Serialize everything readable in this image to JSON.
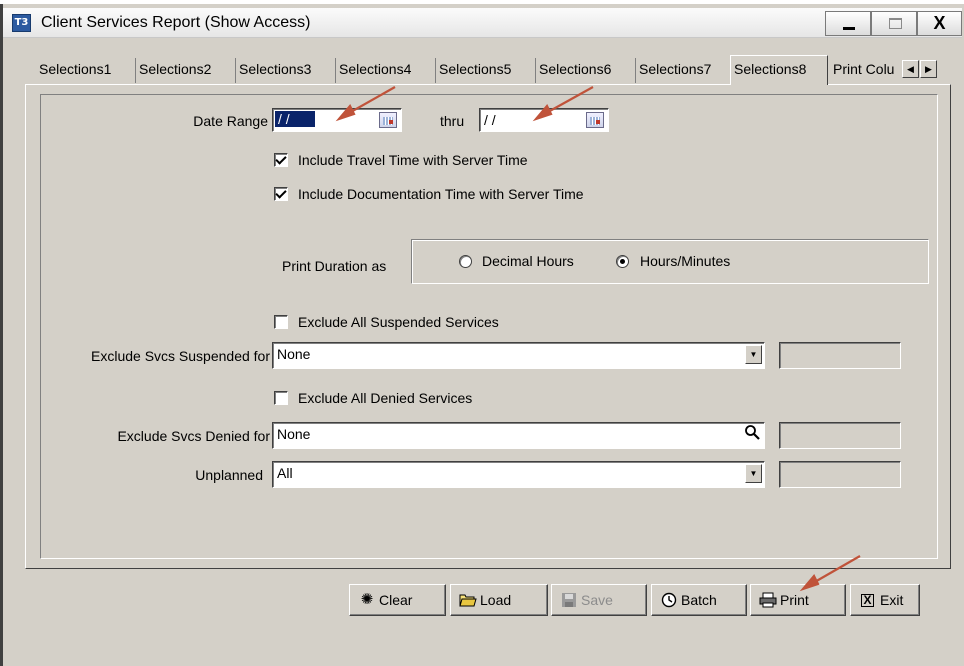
{
  "window": {
    "icon_text": "T3",
    "title": "Client Services Report (Show Access)",
    "min_icon": "minimize-icon",
    "max_icon": "maximize-icon",
    "close_label": "X"
  },
  "tabs": [
    {
      "label": "Selections1"
    },
    {
      "label": "Selections2"
    },
    {
      "label": "Selections3"
    },
    {
      "label": "Selections4"
    },
    {
      "label": "Selections5"
    },
    {
      "label": "Selections6"
    },
    {
      "label": "Selections7"
    },
    {
      "label": "Selections8",
      "active": true
    },
    {
      "label": "Print Colu"
    }
  ],
  "form": {
    "date_range_label": "Date Range",
    "date_from": "/ /",
    "thru_label": "thru",
    "date_to": "/ /",
    "include_travel": {
      "label": "Include Travel Time with Server Time",
      "checked": true
    },
    "include_doc": {
      "label": "Include Documentation Time with Server Time",
      "checked": true
    },
    "print_duration_label": "Print Duration as",
    "duration_options": [
      {
        "label": "Decimal Hours",
        "selected": false
      },
      {
        "label": "Hours/Minutes",
        "selected": true
      }
    ],
    "exclude_suspended": {
      "label": "Exclude All Suspended Services",
      "checked": false
    },
    "suspended_for_label": "Exclude Svcs Suspended for",
    "suspended_for_value": "None",
    "exclude_denied": {
      "label": "Exclude All Denied Services",
      "checked": false
    },
    "denied_for_label": "Exclude Svcs Denied for",
    "denied_for_value": "None",
    "unplanned_label": "Unplanned",
    "unplanned_value": "All"
  },
  "buttons": {
    "clear": "Clear",
    "load": "Load",
    "save": "Save",
    "batch": "Batch",
    "print": "Print",
    "exit": "Exit"
  },
  "colors": {
    "annotation_arrow": "#c0533a",
    "window_face": "#d4d0c8"
  }
}
